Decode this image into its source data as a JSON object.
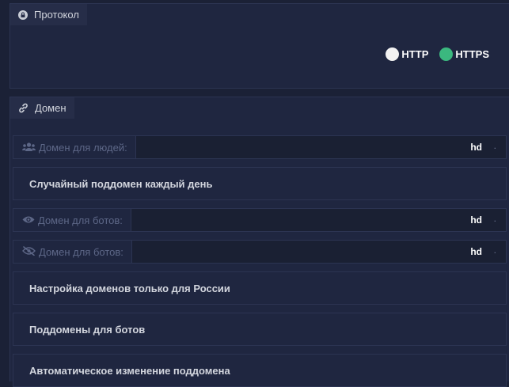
{
  "protocol": {
    "title": "Протокол",
    "icon": "lock-icon",
    "options": [
      {
        "label": "HTTP",
        "color": "#f2f2f2"
      },
      {
        "label": "HTTPS",
        "color": "#3bb87f",
        "selected": true
      }
    ]
  },
  "domain": {
    "title": "Домен",
    "icon": "link-icon",
    "people": {
      "label": "Домен для людей:",
      "icon": "users-icon",
      "value": "hd",
      "suffix": "."
    },
    "random_subdomain": "Случайный поддомен каждый день",
    "bots": {
      "label": "Домен для ботов:",
      "icon": "eye-icon",
      "value": "hd",
      "suffix": "."
    },
    "bots_hidden": {
      "label": "Домен для ботов:",
      "icon": "eye-slash-icon",
      "value": "hd",
      "suffix": "."
    },
    "russia": "Настройка доменов только для России",
    "bot_subdomains": "Поддомены для ботов",
    "auto_change": "Автоматическое изменение поддомена"
  }
}
